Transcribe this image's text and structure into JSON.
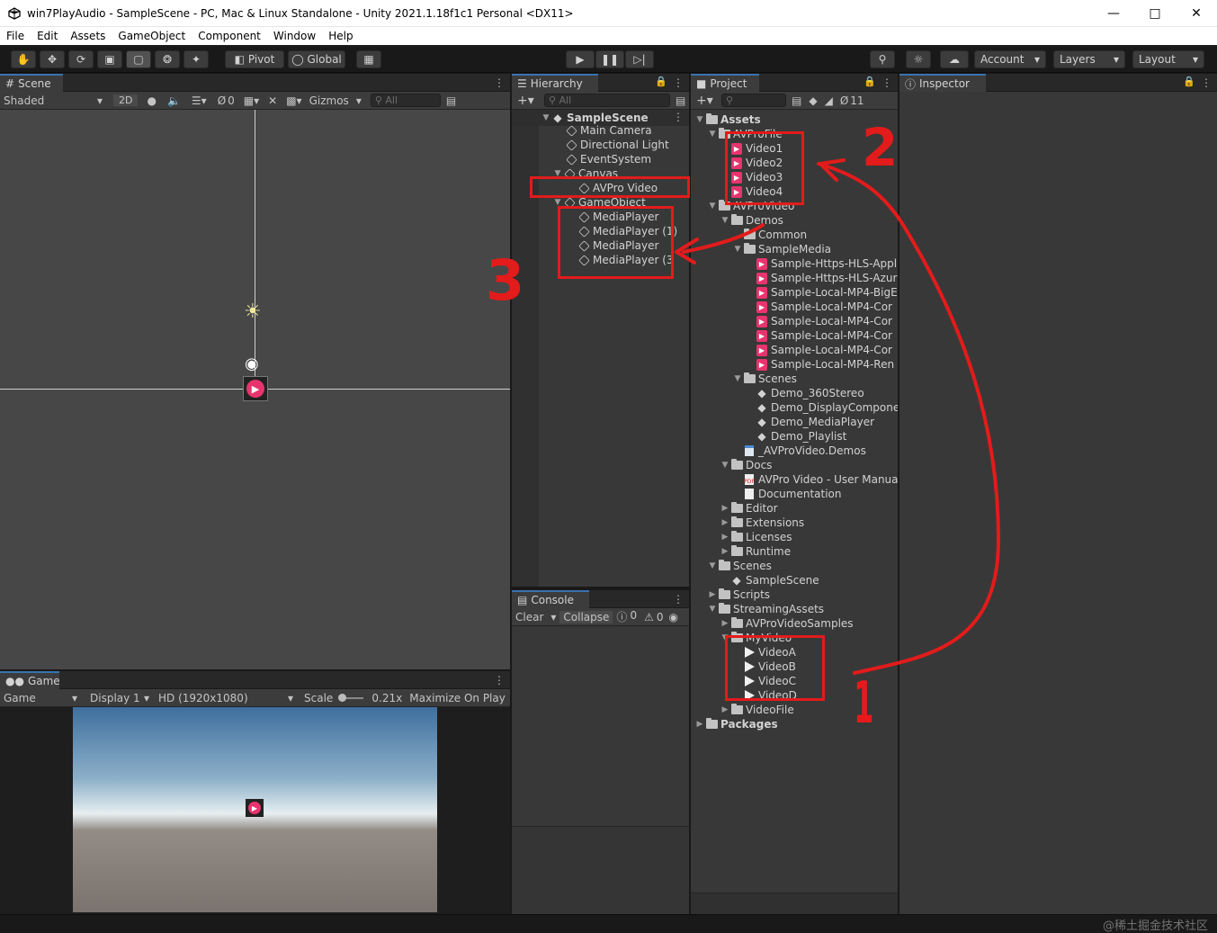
{
  "window": {
    "title": "win7PlayAudio - SampleScene - PC, Mac & Linux Standalone - Unity 2021.1.18f1c1 Personal <DX11>"
  },
  "menu": [
    "File",
    "Edit",
    "Assets",
    "GameObject",
    "Component",
    "Window",
    "Help"
  ],
  "toolbar": {
    "pivot": "Pivot",
    "global": "Global",
    "account": "Account",
    "layers": "Layers",
    "layout": "Layout"
  },
  "scene": {
    "tab": "Scene",
    "shading": "Shaded",
    "mode2d": "2D",
    "hidden_count": "0",
    "gizmos": "Gizmos",
    "search_placeholder": "All"
  },
  "game": {
    "tab": "Game",
    "view": "Game",
    "display": "Display 1",
    "resolution": "HD (1920x1080)",
    "scale_label": "Scale",
    "scale_value": "0.21x",
    "maximize": "Maximize On Play"
  },
  "hierarchy": {
    "tab": "Hierarchy",
    "search_placeholder": "All",
    "scene": "SampleScene",
    "items": [
      {
        "label": "Main Camera"
      },
      {
        "label": "Directional Light"
      },
      {
        "label": "EventSystem"
      },
      {
        "label": "Canvas"
      },
      {
        "label": "AVPro Video"
      },
      {
        "label": "GameObject"
      },
      {
        "label": "MediaPlayer"
      },
      {
        "label": "MediaPlayer (1)"
      },
      {
        "label": "MediaPlayer"
      },
      {
        "label": "MediaPlayer (3"
      }
    ]
  },
  "console": {
    "tab": "Console",
    "clear": "Clear",
    "collapse": "Collapse",
    "info_count": "0",
    "warn_count": "0"
  },
  "project": {
    "tab": "Project",
    "hidden_count": "11",
    "items": [
      {
        "label": "Assets",
        "kind": "folder",
        "bold": true
      },
      {
        "label": "AVProFile",
        "kind": "folder"
      },
      {
        "label": "Video1",
        "kind": "vidpink"
      },
      {
        "label": "Video2",
        "kind": "vidpink"
      },
      {
        "label": "Video3",
        "kind": "vidpink"
      },
      {
        "label": "Video4",
        "kind": "vidpink"
      },
      {
        "label": "AVProVideo",
        "kind": "folder"
      },
      {
        "label": "Demos",
        "kind": "folder"
      },
      {
        "label": "Common",
        "kind": "folder"
      },
      {
        "label": "SampleMedia",
        "kind": "folder"
      },
      {
        "label": "Sample-Https-HLS-Appl",
        "kind": "vidpink"
      },
      {
        "label": "Sample-Https-HLS-Azur",
        "kind": "vidpink"
      },
      {
        "label": "Sample-Local-MP4-BigE",
        "kind": "vidpink"
      },
      {
        "label": "Sample-Local-MP4-Cor",
        "kind": "vidpink"
      },
      {
        "label": "Sample-Local-MP4-Cor",
        "kind": "vidpink"
      },
      {
        "label": "Sample-Local-MP4-Cor",
        "kind": "vidpink"
      },
      {
        "label": "Sample-Local-MP4-Cor",
        "kind": "vidpink"
      },
      {
        "label": "Sample-Local-MP4-Ren",
        "kind": "vidpink"
      },
      {
        "label": "Scenes",
        "kind": "folder"
      },
      {
        "label": "Demo_360Stereo",
        "kind": "scene"
      },
      {
        "label": "Demo_DisplayComponer",
        "kind": "scene"
      },
      {
        "label": "Demo_MediaPlayer",
        "kind": "scene"
      },
      {
        "label": "Demo_Playlist",
        "kind": "scene"
      },
      {
        "label": "_AVProVideo.Demos",
        "kind": "asm"
      },
      {
        "label": "Docs",
        "kind": "folder"
      },
      {
        "label": "AVPro Video - User Manual",
        "kind": "pdf"
      },
      {
        "label": "Documentation",
        "kind": "doc"
      },
      {
        "label": "Editor",
        "kind": "folder"
      },
      {
        "label": "Extensions",
        "kind": "folder"
      },
      {
        "label": "Licenses",
        "kind": "folder"
      },
      {
        "label": "Runtime",
        "kind": "folder"
      },
      {
        "label": "Scenes",
        "kind": "folder"
      },
      {
        "label": "SampleScene",
        "kind": "scene"
      },
      {
        "label": "Scripts",
        "kind": "folder"
      },
      {
        "label": "StreamingAssets",
        "kind": "folder"
      },
      {
        "label": "AVProVideoSamples",
        "kind": "folder"
      },
      {
        "label": "MyVideo",
        "kind": "folder"
      },
      {
        "label": "VideoA",
        "kind": "vidwhite"
      },
      {
        "label": "VideoB",
        "kind": "vidwhite"
      },
      {
        "label": "VideoC",
        "kind": "vidwhite"
      },
      {
        "label": "VideoD",
        "kind": "vidwhite"
      },
      {
        "label": "VideoFile",
        "kind": "folder"
      },
      {
        "label": "Packages",
        "kind": "folder",
        "bold": true
      }
    ]
  },
  "inspector": {
    "tab": "Inspector"
  },
  "annotations": {
    "n1": "1",
    "n2": "2",
    "n3": "3"
  },
  "watermark": "@稀土掘金技术社区",
  "colors": {
    "annotation_red": "#e31b1b",
    "unity_pink": "#e8346e",
    "tab_accent": "#3a72b0"
  }
}
